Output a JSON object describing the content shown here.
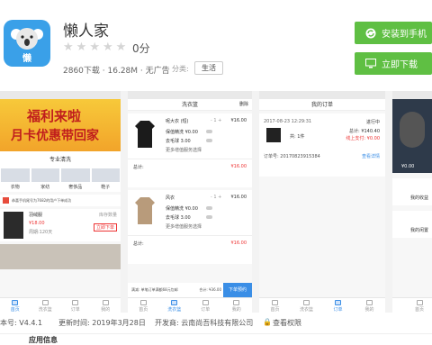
{
  "app": {
    "name": "懒人家",
    "brand": "懒",
    "rating_score": "0分",
    "rating_stars": 0,
    "downloads": "2860下载",
    "size": "16.28M",
    "ads": "无广告",
    "category_label": "分类:",
    "category": "生活"
  },
  "actions": {
    "install_label": "安装到手机",
    "download_label": "立即下载"
  },
  "screenshots": {
    "phone1": {
      "banner_line1": "福利来啦",
      "banner_line2": "月卡优惠带回家",
      "section": "专业清洗",
      "cats": [
        "衣物",
        "家纺",
        "奢侈品",
        "鞋子"
      ],
      "notice": "恭喜手机尾号为7682的用户下单成功",
      "item_name": "羽绒服",
      "item_price": "¥18.00",
      "item_duration": "周期:120天",
      "item_stock": "库存数量",
      "item_add": "立即下单",
      "tabs": [
        "首页",
        "洗衣篮",
        "订单",
        "我的"
      ]
    },
    "phone2": {
      "title": "洗衣篮",
      "delete": "删除",
      "card1": {
        "name": "呢大衣 (短)",
        "qty": "-  1  +",
        "price": "¥16.00",
        "opt1": "保值精洗 ¥0.00",
        "opt2": "去毛球 3.00",
        "opt3": "更多增值服务选择",
        "total_label": "总计:",
        "total": "¥16.00"
      },
      "card2": {
        "name": "风衣",
        "qty": "-  1  +",
        "price": "¥16.00",
        "opt1": "保值精洗 ¥0.00",
        "opt2": "去毛球 3.00",
        "opt3": "更多增值服务选择",
        "total_label": "总计:",
        "total": "¥16.00"
      },
      "footer_note": "满减: 单笔订单满额68元包邮",
      "footer_sum": "合计: ¥36.00",
      "pay": "下单预约",
      "tabs": [
        "首页",
        "洗衣篮",
        "订单",
        "我的"
      ]
    },
    "phone3": {
      "title": "我的订单",
      "date": "2017-08-23 12:29:31",
      "status": "进行中",
      "count": "共: 1件",
      "total": "总计: ¥140.40",
      "paid": "线上支付: ¥0.00",
      "order_no": "订单号: 20170823915384",
      "detail": "查看详情",
      "tabs": [
        "首页",
        "洗衣篮",
        "订单",
        "我的"
      ]
    },
    "phone4": {
      "money": "¥0.00",
      "fns": [
        "我的收益",
        "我的闲置"
      ],
      "tabs": [
        "首页"
      ]
    }
  },
  "info": {
    "version": "版本号: V4.4.1",
    "update_time": "更新时间: 2019年3月28日",
    "developer": "开发商: 云南尚吾科技有限公司",
    "permissions": "查看权限"
  },
  "section_title": "应用信息",
  "colors": {
    "accent": "#5fbf43",
    "price": "#e33333",
    "link": "#3a8ee6"
  }
}
